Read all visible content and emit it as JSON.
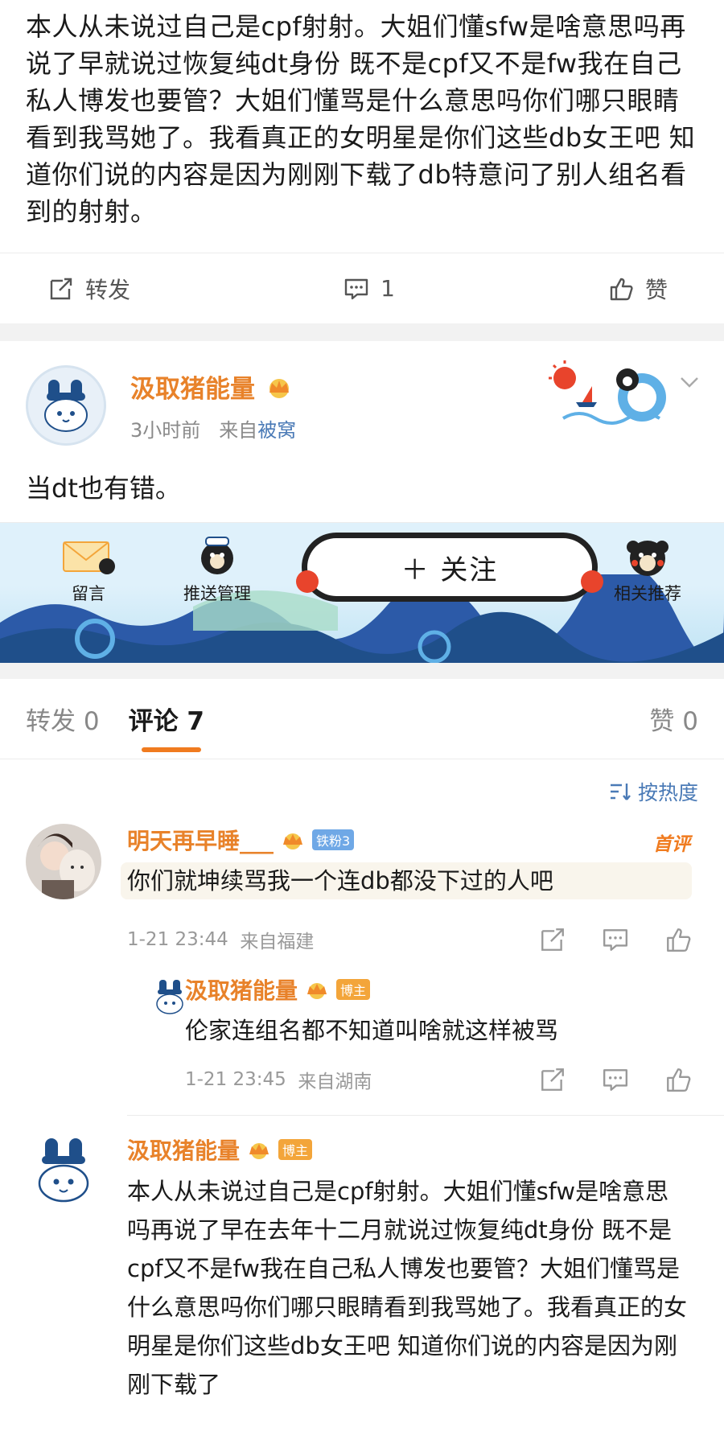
{
  "top_post": {
    "text": "本人从未说过自己是cpf射射。大姐们懂sfw是啥意思吗再说了早就说过恢复纯dt身份 既不是cpf又不是fw我在自己私人博发也要管？大姐们懂骂是什么意思吗你们哪只眼睛看到我骂她了。我看真正的女明星是你们这些db女王吧 知道你们说的内容是因为刚刚下载了db特意问了别人组名看到的射射。",
    "actions": {
      "repost": "转发",
      "comment_count": "1",
      "like": "赞"
    }
  },
  "author_card": {
    "name": "汲取猪能量",
    "time": "3小时前",
    "from_prefix": "来自",
    "source": "被窝",
    "text": "当dt也有错。"
  },
  "banner": {
    "message": "留言",
    "push": "推送管理",
    "follow": "＋ 关注",
    "related": "相关推荐"
  },
  "tabs": {
    "repost": "转发 0",
    "comment": "评论 7",
    "like": "赞 0"
  },
  "sort": {
    "label": "按热度"
  },
  "comments": [
    {
      "name": "明天再早睡___",
      "tag": "铁粉3",
      "hot": "首评",
      "text": "你们就坤续骂我一个连db都没下过的人吧",
      "time": "1-21 23:44",
      "location": "来自福建",
      "reply": {
        "name": "汲取猪能量",
        "tag": "博主",
        "text": "伦家连组名都不知道叫啥就这样被骂",
        "time": "1-21 23:45",
        "location": "来自湖南"
      }
    },
    {
      "name": "汲取猪能量",
      "tag": "博主",
      "text": "本人从未说过自己是cpf射射。大姐们懂sfw是啥意思吗再说了早在去年十二月就说过恢复纯dt身份 既不是cpf又不是fw我在自己私人博发也要管？大姐们懂骂是什么意思吗你们哪只眼睛看到我骂她了。我看真正的女明星是你们这些db女王吧 知道你们说的内容是因为刚刚下载了"
    }
  ],
  "colors": {
    "accent": "#f07b1f",
    "name": "#e8822a",
    "link": "#4a7ab6"
  }
}
